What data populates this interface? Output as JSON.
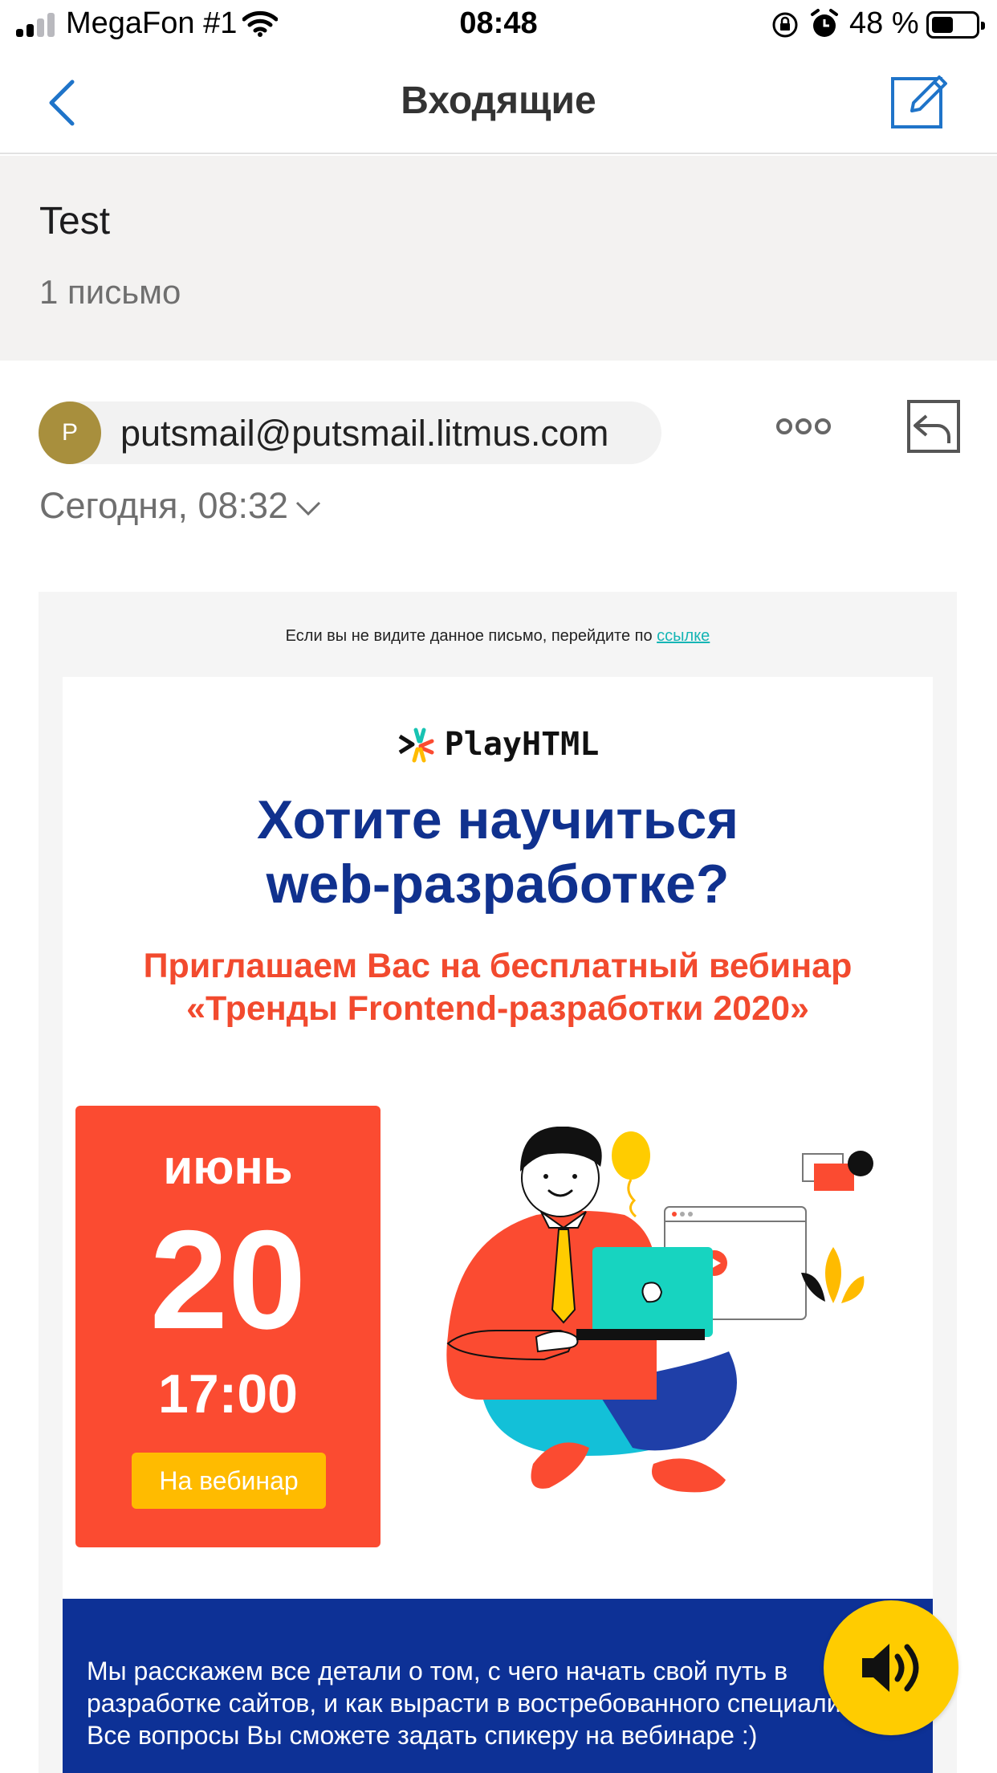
{
  "status_bar": {
    "carrier": "MegaFon #1",
    "time": "08:48",
    "battery_percent": "48 %"
  },
  "nav": {
    "title": "Входящие"
  },
  "folder": {
    "name": "Test",
    "count": "1 письмо"
  },
  "message": {
    "avatar_initial": "P",
    "sender": "putsmail@putsmail.litmus.com",
    "date": "Сегодня, 08:32"
  },
  "email": {
    "preheader_text": "Если вы не видите данное письмо, перейдите по ",
    "preheader_link": "ссылке",
    "logo_text": "PlayHTML",
    "headline_line1": "Хотите научиться",
    "headline_line2": "web-разработке?",
    "subheadline": "Приглашаем Вас на бесплатный вебинар «Тренды Frontend-разработки 2020»",
    "month": "июнь",
    "day": "20",
    "time": "17:00",
    "button_label": "На вебинар",
    "info_text": "Мы расскажем все детали о том, с чего начать свой путь в разработке сайтов, и как вырасти в востребованного специалиста. Все вопросы Вы сможете задать спикеру на вебинаре :)"
  },
  "colors": {
    "headline": "#10318e",
    "accent_red": "#fb4b31",
    "button_yellow": "#ffbb00",
    "info_bg": "#0d3196",
    "link": "#16b5b5",
    "fab": "#ffcc00"
  },
  "icons": {
    "back": "chevron-left-icon",
    "compose": "compose-icon",
    "more": "more-dots-icon",
    "reply": "reply-icon",
    "expand": "chevron-down-icon",
    "sound": "speaker-icon"
  }
}
